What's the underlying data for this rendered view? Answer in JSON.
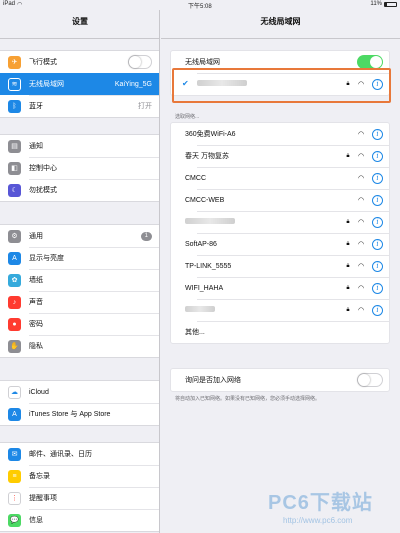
{
  "status_bar": {
    "device": "iPad",
    "time": "下午5:08",
    "battery": "11%"
  },
  "sidebar": {
    "title": "设置",
    "groups": [
      [
        {
          "label": "飞行模式",
          "icon": "airplane-icon",
          "color": "#f7a033",
          "type": "toggle-off"
        },
        {
          "label": "无线局域网",
          "icon": "wifi-icon",
          "color": "#1d88e6",
          "value": "KaiYing_5G",
          "active": true
        },
        {
          "label": "蓝牙",
          "icon": "bluetooth-icon",
          "color": "#1d88e6",
          "value": "打开"
        }
      ],
      [
        {
          "label": "通知",
          "icon": "notification-icon",
          "color": "#8e8e93"
        },
        {
          "label": "控制中心",
          "icon": "control-center-icon",
          "color": "#8e8e93"
        },
        {
          "label": "勿扰模式",
          "icon": "moon-icon",
          "color": "#5856d6"
        }
      ],
      [
        {
          "label": "通用",
          "icon": "gear-icon",
          "color": "#8e8e93",
          "badge": "1"
        },
        {
          "label": "显示与亮度",
          "icon": "brightness-icon",
          "color": "#1d88e6"
        },
        {
          "label": "墙纸",
          "icon": "wallpaper-icon",
          "color": "#35aadc"
        },
        {
          "label": "声音",
          "icon": "sound-icon",
          "color": "#ff3b30"
        },
        {
          "label": "密码",
          "icon": "lock-icon",
          "color": "#ff3b30"
        },
        {
          "label": "隐私",
          "icon": "hand-icon",
          "color": "#8e8e93"
        }
      ],
      [
        {
          "label": "iCloud",
          "icon": "cloud-icon",
          "color": "#ffffff"
        },
        {
          "label": "iTunes Store 与 App Store",
          "icon": "app-store-icon",
          "color": "#1d88e6"
        }
      ],
      [
        {
          "label": "邮件、通讯录、日历",
          "icon": "mail-icon",
          "color": "#1d88e6"
        },
        {
          "label": "备忘录",
          "icon": "notes-icon",
          "color": "#ffcc00"
        },
        {
          "label": "提醒事项",
          "icon": "reminders-icon",
          "color": "#ffffff"
        },
        {
          "label": "信息",
          "icon": "messages-icon",
          "color": "#4cd964"
        }
      ]
    ]
  },
  "detail": {
    "title": "无线局域网",
    "wifi_toggle_label": "无线局域网",
    "choose_network_header": "选取网络...",
    "networks": [
      {
        "name": "360免费WiFi-A6",
        "locked": false
      },
      {
        "name": "春天 万物复苏",
        "locked": true
      },
      {
        "name": "CMCC",
        "locked": false
      },
      {
        "name": "CMCC-WEB",
        "locked": false
      },
      {
        "name": "",
        "locked": true,
        "hidden_name": true
      },
      {
        "name": "SoftAP-86",
        "locked": true
      },
      {
        "name": "TP-LINK_5555",
        "locked": true
      },
      {
        "name": "WIFI_HAHA",
        "locked": true
      },
      {
        "name": "",
        "locked": true,
        "hidden_name": true
      }
    ],
    "other_label": "其他...",
    "ask_join_label": "询问是否加入网络",
    "ask_join_note": "将自动加入已知网络。如果没有已知网络，您必须手动选择网络。"
  },
  "watermark": {
    "brand": "PC6下载站",
    "url": "http://www.pc6.com"
  }
}
